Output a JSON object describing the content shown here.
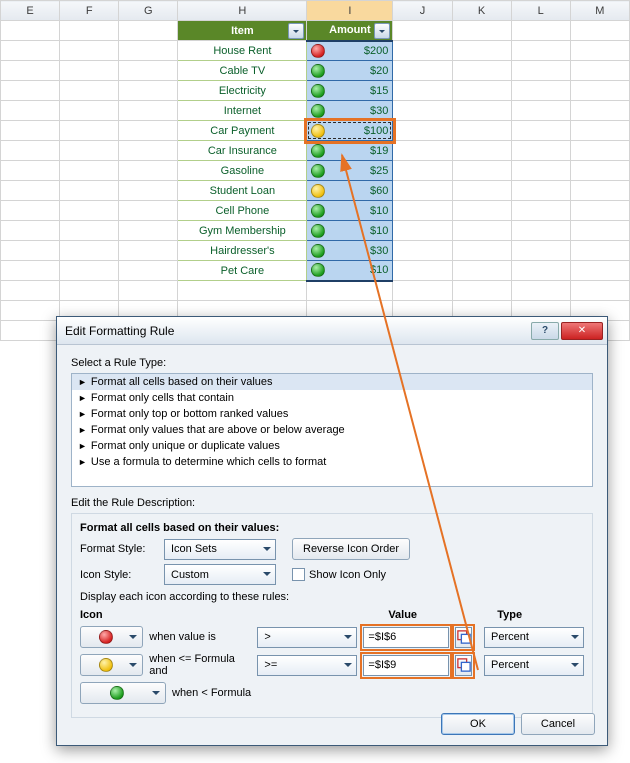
{
  "columns": [
    "E",
    "F",
    "G",
    "H",
    "I",
    "J",
    "K",
    "L",
    "M"
  ],
  "table_header": {
    "item": "Item",
    "amount": "Amount"
  },
  "rows": [
    {
      "item": "House Rent",
      "amount": "$200",
      "icon": "red"
    },
    {
      "item": "Cable TV",
      "amount": "$20",
      "icon": "green"
    },
    {
      "item": "Electricity",
      "amount": "$15",
      "icon": "green"
    },
    {
      "item": "Internet",
      "amount": "$30",
      "icon": "green"
    },
    {
      "item": "Car Payment",
      "amount": "$100",
      "icon": "yellow",
      "highlighted": true
    },
    {
      "item": "Car Insurance",
      "amount": "$19",
      "icon": "green"
    },
    {
      "item": "Gasoline",
      "amount": "$25",
      "icon": "green"
    },
    {
      "item": "Student Loan",
      "amount": "$60",
      "icon": "yellow"
    },
    {
      "item": "Cell Phone",
      "amount": "$10",
      "icon": "green"
    },
    {
      "item": "Gym Membership",
      "amount": "$10",
      "icon": "green"
    },
    {
      "item": "Hairdresser's",
      "amount": "$30",
      "icon": "green"
    },
    {
      "item": "Pet Care",
      "amount": "$10",
      "icon": "green"
    }
  ],
  "dialog": {
    "title": "Edit Formatting Rule",
    "select_rule_label": "Select a Rule Type:",
    "rule_types": [
      "Format all cells based on their values",
      "Format only cells that contain",
      "Format only top or bottom ranked values",
      "Format only values that are above or below average",
      "Format only unique or duplicate values",
      "Use a formula to determine which cells to format"
    ],
    "edit_desc_label": "Edit the Rule Description:",
    "format_header": "Format all cells based on their values:",
    "format_style_label": "Format Style:",
    "format_style_value": "Icon Sets",
    "reverse_btn": "Reverse Icon Order",
    "icon_style_label": "Icon Style:",
    "icon_style_value": "Custom",
    "show_icon_only_label": "Show Icon Only",
    "display_rules_label": "Display each icon according to these rules:",
    "col_icon": "Icon",
    "col_value": "Value",
    "col_type": "Type",
    "rules": [
      {
        "icon": "red",
        "text": "when value is",
        "op": ">",
        "value": "=$I$6",
        "type": "Percent"
      },
      {
        "icon": "yellow",
        "text": "when <= Formula and",
        "op": ">=",
        "value": "=$I$9",
        "type": "Percent"
      },
      {
        "icon": "green",
        "text": "when < Formula",
        "op": "",
        "value": "",
        "type": ""
      }
    ],
    "ok": "OK",
    "cancel": "Cancel"
  }
}
